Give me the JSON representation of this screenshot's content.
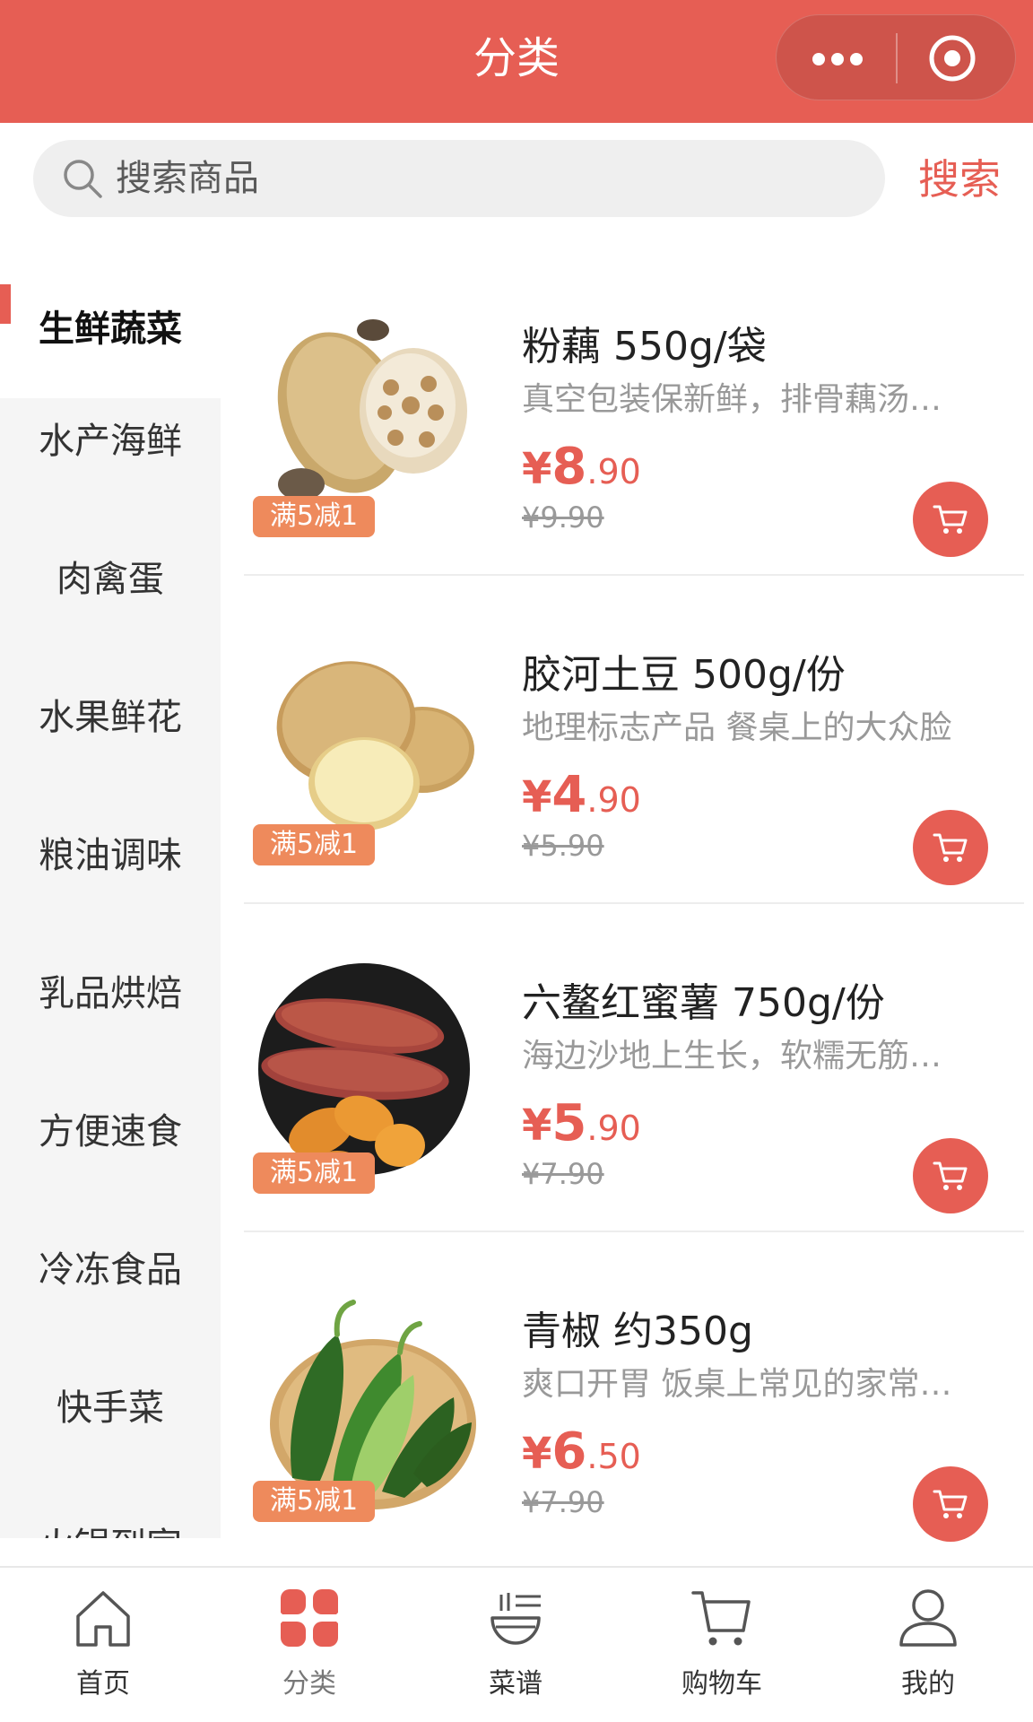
{
  "header": {
    "title": "分类",
    "accent_color": "#e65e54",
    "more_icon": "more-dots-icon",
    "close_icon": "target-circle-icon"
  },
  "search": {
    "placeholder": "搜索商品",
    "button_label": "搜索",
    "icon": "search-icon"
  },
  "sidebar": {
    "items": [
      {
        "label": "生鲜蔬菜",
        "active": true
      },
      {
        "label": "水产海鲜",
        "active": false
      },
      {
        "label": "肉禽蛋",
        "active": false
      },
      {
        "label": "水果鲜花",
        "active": false
      },
      {
        "label": "粮油调味",
        "active": false
      },
      {
        "label": "乳品烘焙",
        "active": false
      },
      {
        "label": "方便速食",
        "active": false
      },
      {
        "label": "冷冻食品",
        "active": false
      },
      {
        "label": "快手菜",
        "active": false
      },
      {
        "label": "火锅到家",
        "active": false
      }
    ]
  },
  "products": [
    {
      "name": "粉藕 550g/袋",
      "desc": "真空包装保新鲜，排骨藕汤…",
      "price_symbol": "¥",
      "price_int": "8",
      "price_dec": ".90",
      "old_price": "¥9.90",
      "badge": "满5减1",
      "image": "lotus-root-image"
    },
    {
      "name": "胶河土豆 500g/份",
      "desc": "地理标志产品 餐桌上的大众脸",
      "price_symbol": "¥",
      "price_int": "4",
      "price_dec": ".90",
      "old_price": "¥5.90",
      "badge": "满5减1",
      "image": "potato-image"
    },
    {
      "name": "六鳌红蜜薯 750g/份",
      "desc": "海边沙地上生长，软糯无筋…",
      "price_symbol": "¥",
      "price_int": "5",
      "price_dec": ".90",
      "old_price": "¥7.90",
      "badge": "满5减1",
      "image": "sweet-potato-image"
    },
    {
      "name": "青椒 约350g",
      "desc": "爽口开胃 饭桌上常见的家常…",
      "price_symbol": "¥",
      "price_int": "6",
      "price_dec": ".50",
      "old_price": "¥7.90",
      "badge": "满5减1",
      "image": "green-pepper-image"
    }
  ],
  "tabbar": {
    "items": [
      {
        "label": "首页",
        "icon": "home-icon",
        "active": false
      },
      {
        "label": "分类",
        "icon": "category-icon",
        "active": true
      },
      {
        "label": "菜谱",
        "icon": "recipe-bowl-icon",
        "active": false
      },
      {
        "label": "购物车",
        "icon": "cart-icon",
        "active": false
      },
      {
        "label": "我的",
        "icon": "user-icon",
        "active": false
      }
    ]
  }
}
